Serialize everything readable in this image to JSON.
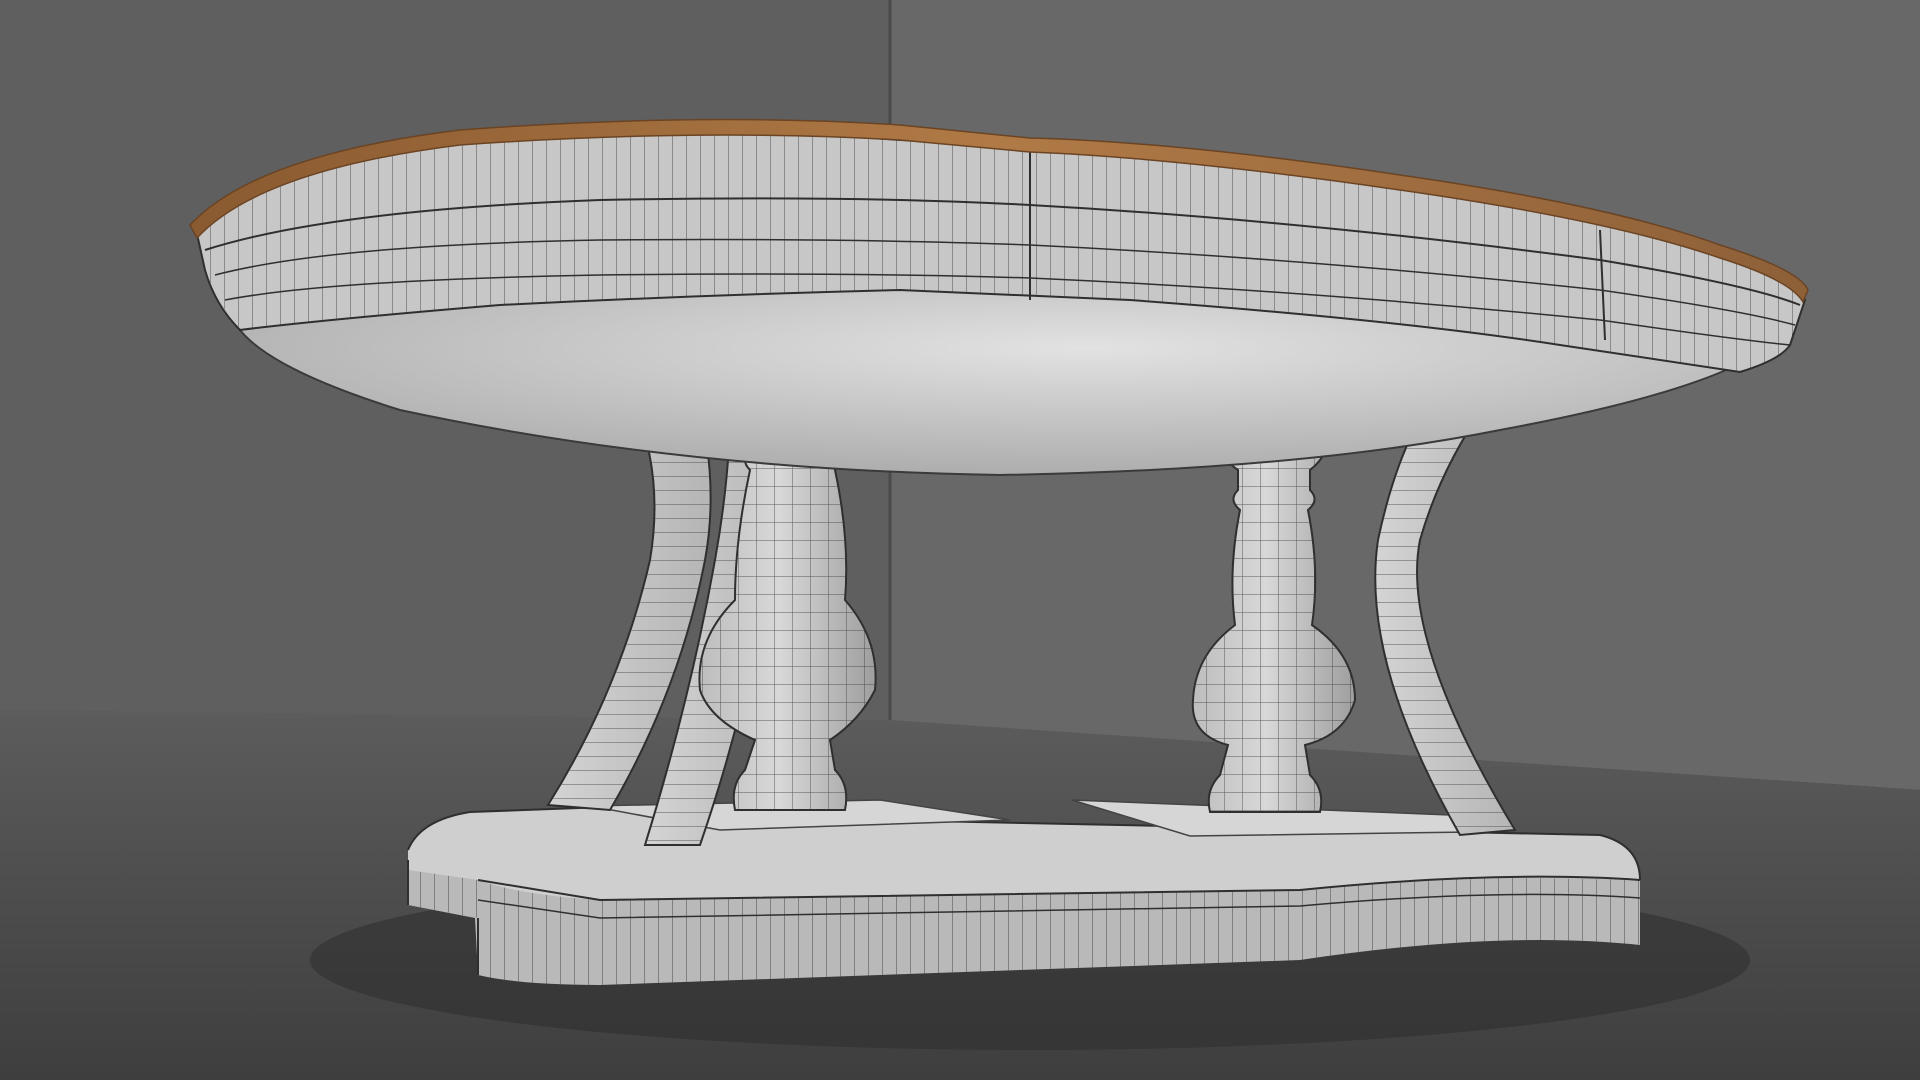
{
  "scene": {
    "colors": {
      "back_wall": "#666666",
      "left_wall": "#5b5b5b",
      "floor": "#454545",
      "model_surface": "#c9c9c9",
      "model_shadow": "#8f8f8f",
      "wireframe": "#2b2b2b",
      "tabletop_trim": "#9a6a3c"
    }
  }
}
